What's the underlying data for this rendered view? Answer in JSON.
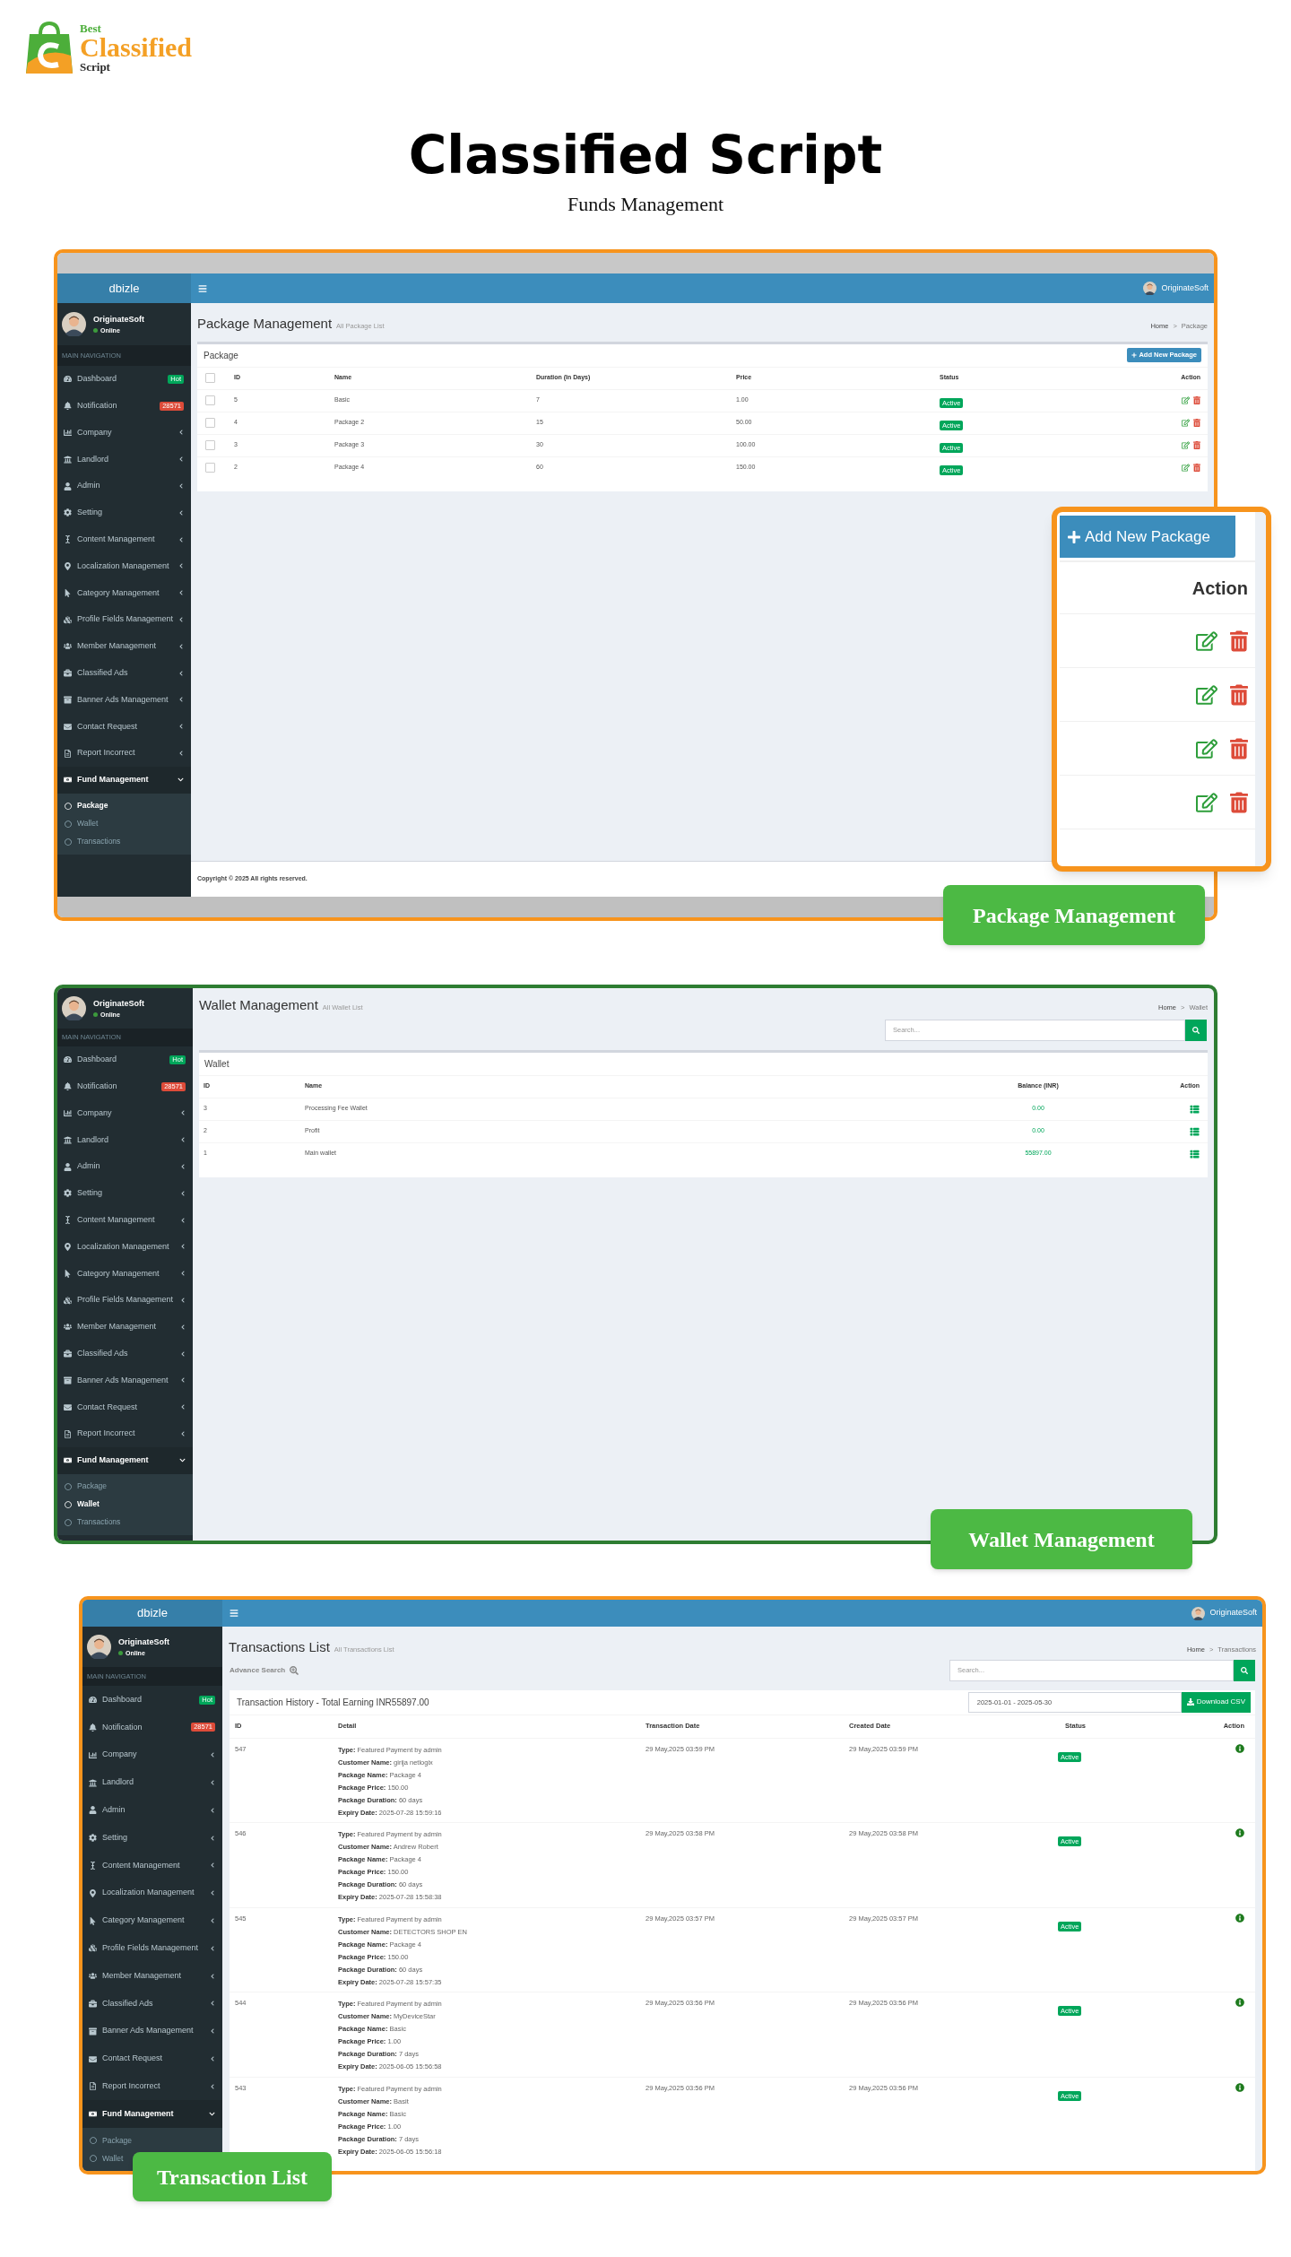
{
  "logo": {
    "top": "Best",
    "main": "Classified",
    "bottom": "Script"
  },
  "title": "Classified Script",
  "subtitle": "Funds Management",
  "package_panel": {
    "app_name": "dbizle",
    "header_user": "OriginateSoft",
    "sidebar": {
      "user": {
        "name": "OriginateSoft",
        "status": "Online"
      },
      "nav_header": "MAIN NAVIGATION",
      "items": [
        {
          "label": "Dashboard",
          "kind": "badge",
          "badge": "Hot",
          "color": "#00a65a"
        },
        {
          "label": "Notification",
          "kind": "badge",
          "badge": "28571",
          "color": "#dd4b39"
        },
        {
          "label": "Company",
          "kind": "menu",
          "expanded": false
        },
        {
          "label": "Landlord",
          "kind": "menu",
          "expanded": false
        },
        {
          "label": "Admin",
          "kind": "menu",
          "expanded": false
        },
        {
          "label": "Setting",
          "kind": "menu",
          "expanded": false
        },
        {
          "label": "Content Management",
          "kind": "menu",
          "expanded": false
        },
        {
          "label": "Localization Management",
          "kind": "menu",
          "expanded": false
        },
        {
          "label": "Category Management",
          "kind": "menu",
          "expanded": false
        },
        {
          "label": "Profile Fields Management",
          "kind": "menu",
          "expanded": false
        },
        {
          "label": "Member Management",
          "kind": "menu",
          "expanded": false
        },
        {
          "label": "Classified Ads",
          "kind": "menu",
          "expanded": false
        },
        {
          "label": "Banner Ads Management",
          "kind": "menu",
          "expanded": false
        },
        {
          "label": "Contact Request",
          "kind": "menu",
          "expanded": false
        },
        {
          "label": "Report Incorrect",
          "kind": "menu",
          "expanded": false
        },
        {
          "label": "Fund Management",
          "kind": "menu",
          "expanded": true,
          "children": [
            {
              "label": "Package",
              "selected": true
            },
            {
              "label": "Wallet",
              "selected": false
            },
            {
              "label": "Transactions",
              "selected": false
            }
          ]
        }
      ]
    },
    "page": {
      "title": "Package Management",
      "subtitle": "All Package List",
      "breadcrumb": {
        "items": [
          "Home",
          "Package"
        ],
        "separator": ">"
      },
      "box_title": "Package",
      "add_button": "Add New Package",
      "select_all": false,
      "columns": [
        "ID",
        "Name",
        "Duration (In Days)",
        "Price",
        "Status",
        "Action"
      ],
      "rows": [
        {
          "id": "5",
          "name": "Basic",
          "duration": "7",
          "price": "1.00",
          "status": "Active",
          "checked": false
        },
        {
          "id": "4",
          "name": "Package 2",
          "duration": "15",
          "price": "50.00",
          "status": "Active",
          "checked": false
        },
        {
          "id": "3",
          "name": "Package 3",
          "duration": "30",
          "price": "100.00",
          "status": "Active",
          "checked": false
        },
        {
          "id": "2",
          "name": "Package 4",
          "duration": "60",
          "price": "150.00",
          "status": "Active",
          "checked": false
        }
      ]
    },
    "footer": "Copyright © 2025 All rights reserved.",
    "callout": {
      "button": "Add New Package",
      "header": "Action"
    },
    "caption": "Package Management"
  },
  "wallet_panel": {
    "sidebar": {
      "user": {
        "name": "OriginateSoft",
        "status": "Online"
      },
      "nav_header": "MAIN NAVIGATION",
      "items": [
        {
          "label": "Dashboard",
          "kind": "badge",
          "badge": "Hot",
          "color": "#00a65a"
        },
        {
          "label": "Notification",
          "kind": "badge",
          "badge": "28571",
          "color": "#dd4b39"
        },
        {
          "label": "Company",
          "kind": "menu",
          "expanded": false
        },
        {
          "label": "Landlord",
          "kind": "menu",
          "expanded": false
        },
        {
          "label": "Admin",
          "kind": "menu",
          "expanded": false
        },
        {
          "label": "Setting",
          "kind": "menu",
          "expanded": false
        },
        {
          "label": "Content Management",
          "kind": "menu",
          "expanded": false
        },
        {
          "label": "Localization Management",
          "kind": "menu",
          "expanded": false
        },
        {
          "label": "Category Management",
          "kind": "menu",
          "expanded": false
        },
        {
          "label": "Profile Fields Management",
          "kind": "menu",
          "expanded": false
        },
        {
          "label": "Member Management",
          "kind": "menu",
          "expanded": false
        },
        {
          "label": "Classified Ads",
          "kind": "menu",
          "expanded": false
        },
        {
          "label": "Banner Ads Management",
          "kind": "menu",
          "expanded": false
        },
        {
          "label": "Contact Request",
          "kind": "menu",
          "expanded": false
        },
        {
          "label": "Report Incorrect",
          "kind": "menu",
          "expanded": false
        },
        {
          "label": "Fund Management",
          "kind": "menu",
          "expanded": true,
          "children": [
            {
              "label": "Package",
              "selected": false
            },
            {
              "label": "Wallet",
              "selected": true
            },
            {
              "label": "Transactions",
              "selected": false
            }
          ]
        }
      ]
    },
    "page": {
      "title": "Wallet Management",
      "subtitle": "All Wallet List",
      "breadcrumb": {
        "items": [
          "Home",
          "Wallet"
        ],
        "separator": ">"
      },
      "search_placeholder": "Search...",
      "box_title": "Wallet",
      "columns": [
        "ID",
        "Name",
        "Balance (INR)",
        "Action"
      ],
      "rows": [
        {
          "id": "3",
          "name": "Processing Fee Wallet",
          "balance": "0.00"
        },
        {
          "id": "2",
          "name": "Profit",
          "balance": "0.00"
        },
        {
          "id": "1",
          "name": "Main wallet",
          "balance": "55897.00"
        }
      ]
    },
    "caption": "Wallet Management"
  },
  "transactions_panel": {
    "app_name": "dbizle",
    "header_user": "OriginateSoft",
    "sidebar": {
      "user": {
        "name": "OriginateSoft",
        "status": "Online"
      },
      "nav_header": "MAIN NAVIGATION",
      "items": [
        {
          "label": "Dashboard",
          "kind": "badge",
          "badge": "Hot",
          "color": "#00a65a"
        },
        {
          "label": "Notification",
          "kind": "badge",
          "badge": "28571",
          "color": "#dd4b39"
        },
        {
          "label": "Company",
          "kind": "menu",
          "expanded": false
        },
        {
          "label": "Landlord",
          "kind": "menu",
          "expanded": false
        },
        {
          "label": "Admin",
          "kind": "menu",
          "expanded": false
        },
        {
          "label": "Setting",
          "kind": "menu",
          "expanded": false
        },
        {
          "label": "Content Management",
          "kind": "menu",
          "expanded": false
        },
        {
          "label": "Localization Management",
          "kind": "menu",
          "expanded": false
        },
        {
          "label": "Category Management",
          "kind": "menu",
          "expanded": false
        },
        {
          "label": "Profile Fields Management",
          "kind": "menu",
          "expanded": false
        },
        {
          "label": "Member Management",
          "kind": "menu",
          "expanded": false
        },
        {
          "label": "Classified Ads",
          "kind": "menu",
          "expanded": false
        },
        {
          "label": "Banner Ads Management",
          "kind": "menu",
          "expanded": false
        },
        {
          "label": "Contact Request",
          "kind": "menu",
          "expanded": false
        },
        {
          "label": "Report Incorrect",
          "kind": "menu",
          "expanded": false
        },
        {
          "label": "Fund Management",
          "kind": "menu",
          "expanded": true,
          "children": [
            {
              "label": "Package",
              "selected": false
            },
            {
              "label": "Wallet",
              "selected": false
            }
          ]
        }
      ]
    },
    "page": {
      "title": "Transactions List",
      "subtitle": "All Transactions List",
      "breadcrumb": {
        "items": [
          "Home",
          "Transactions"
        ],
        "separator": ">"
      },
      "advance_search": "Advance Search",
      "search_placeholder": "Search...",
      "box_title": "Transaction History - Total Earning INR55897.00",
      "date_range": "2025-01-01 - 2025-05-30",
      "download_button": "Download CSV",
      "columns": [
        "ID",
        "Detail",
        "Transaction Date",
        "Created Date",
        "Status",
        "Action"
      ],
      "rows": [
        {
          "id": "547",
          "details": [
            "**Type:** Featured Payment by admin",
            "**Customer Name:** girija netlogix",
            "**Package Name:** Package 4",
            "**Package Price:** 150.00",
            "**Package Duration:** 60 days",
            "**Expiry Date:** 2025-07-28 15:59:16"
          ],
          "transaction_date": "29 May,2025 03:59 PM",
          "created_date": "29 May,2025 03:59 PM",
          "status": "Active"
        },
        {
          "id": "546",
          "details": [
            "**Type:** Featured Payment by admin",
            "**Customer Name:** Andrew Robert",
            "**Package Name:** Package 4",
            "**Package Price:** 150.00",
            "**Package Duration:** 60 days",
            "**Expiry Date:** 2025-07-28 15:58:38"
          ],
          "transaction_date": "29 May,2025 03:58 PM",
          "created_date": "29 May,2025 03:58 PM",
          "status": "Active"
        },
        {
          "id": "545",
          "details": [
            "**Type:** Featured Payment by admin",
            "**Customer Name:** DETECTORS SHOP EN",
            "**Package Name:** Package 4",
            "**Package Price:** 150.00",
            "**Package Duration:** 60 days",
            "**Expiry Date:** 2025-07-28 15:57:35"
          ],
          "transaction_date": "29 May,2025 03:57 PM",
          "created_date": "29 May,2025 03:57 PM",
          "status": "Active"
        },
        {
          "id": "544",
          "details": [
            "**Type:** Featured Payment by admin",
            "**Customer Name:** MyDeviceStar",
            "**Package Name:** Basic",
            "**Package Price:** 1.00",
            "**Package Duration:** 7 days",
            "**Expiry Date:** 2025-06-05 15:56:58"
          ],
          "transaction_date": "29 May,2025 03:56 PM",
          "created_date": "29 May,2025 03:56 PM",
          "status": "Active"
        },
        {
          "id": "543",
          "details": [
            "**Type:** Featured Payment by admin",
            "**Customer Name:** Basit",
            "**Package Name:** Basic",
            "**Package Price:** 1.00",
            "**Package Duration:** 7 days",
            "**Expiry Date:** 2025-06-05 15:56:18"
          ],
          "transaction_date": "29 May,2025 03:56 PM",
          "created_date": "29 May,2025 03:56 PM",
          "status": "Active"
        }
      ]
    },
    "caption": "Transaction List"
  }
}
